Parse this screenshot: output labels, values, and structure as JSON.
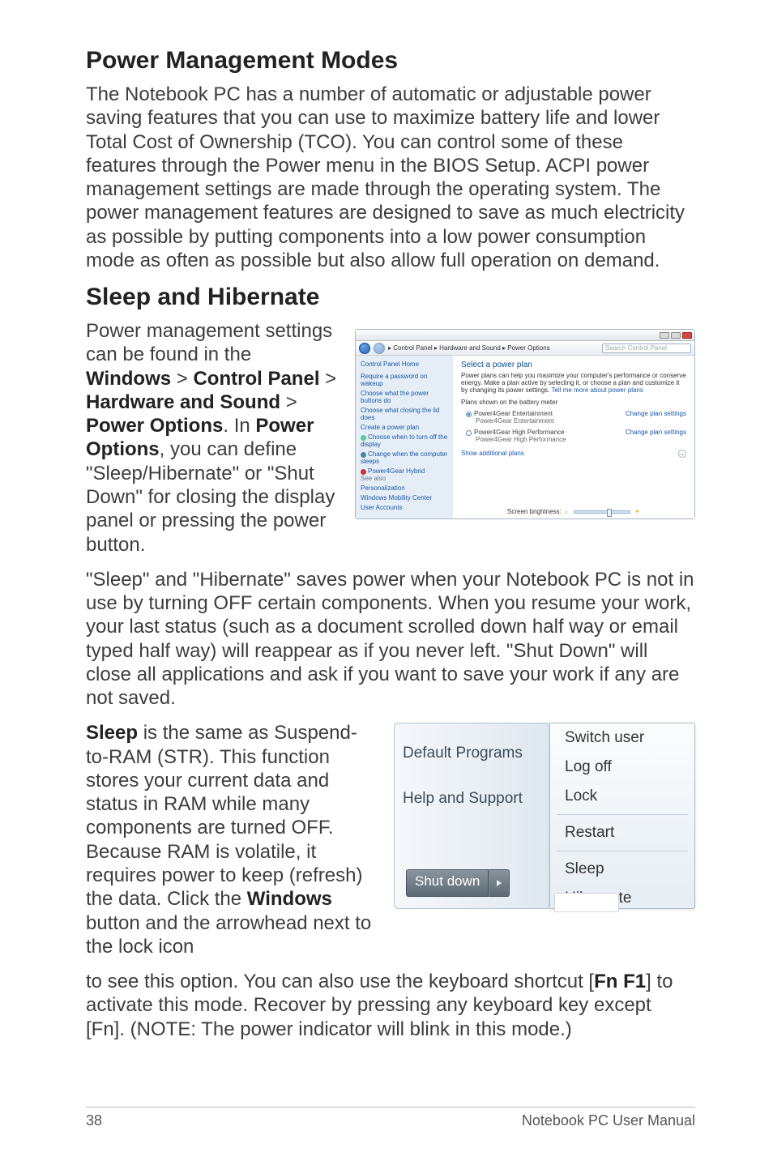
{
  "headings": {
    "h1": "Power Management Modes",
    "h2": "Sleep and Hibernate"
  },
  "paragraphs": {
    "p1": "The Notebook PC has a number of automatic or adjustable power saving features that you can use to maximize battery life and lower Total Cost of Ownership (TCO). You can control some of these features through the Power menu in the BIOS Setup. ACPI power management settings are made through the operating system. The power management features are designed to save as much electricity as possible by putting components into a low power consumption mode as often as possible but also allow full operation on demand.",
    "p2_pre": "Power management settings can be found in the ",
    "p2_b1": "Windows",
    "p2_gt1": " > ",
    "p2_b2": "Control Panel",
    "p2_gt2": " > ",
    "p2_b3": "Hardware and Sound",
    "p2_gt3": " > ",
    "p2_b4": "Power Options",
    "p2_mid": ". In ",
    "p2_b5": "Power Options",
    "p2_post": ", you can define \"Sleep/Hibernate\" or \"Shut Down\" for closing the display panel or pressing the power button.",
    "p3": "\"Sleep\" and \"Hibernate\" saves power when your Notebook PC is not in use by turning OFF certain components. When you resume your work, your last status (such as a document scrolled down half way or email typed half way) will reappear as if you never left. \"Shut Down\" will close all applications and ask if you want to save your work if any are not saved.",
    "p4_b1": "Sleep",
    "p4_a": " is the same as Suspend-to-RAM (STR). This function stores your current data and status in RAM while many components are turned OFF. Because RAM is volatile, it requires power to keep (refresh) the data. Click the ",
    "p4_b2": "Windows",
    "p4_b": " button and the arrowhead next to the lock icon",
    "p5_a": "to see this option. You can also use the keyboard shortcut [",
    "p5_b1": "Fn F1",
    "p5_b": "] to activate this mode. Recover by pressing any keyboard key except [Fn]. (NOTE: The power indicator will blink in this mode.)"
  },
  "shot1": {
    "breadcrumb": "  ▸ Control Panel ▸ Hardware and Sound ▸ Power Options",
    "search_placeholder": "Search Control Panel",
    "side_heading": "Control Panel Home",
    "side_links": {
      "l1": "Require a password on wakeup",
      "l2": "Choose what the power buttons do",
      "l3": "Choose what closing the lid does",
      "l4": "Create a power plan",
      "l5": "Choose when to turn off the display",
      "l6": "Change when the computer sleeps",
      "l7": "Power4Gear Hybrid"
    },
    "see_also": "See also",
    "see_also_links": {
      "a1": "Personalization",
      "a2": "Windows Mobility Center",
      "a3": "User Accounts"
    },
    "main_heading": "Select a power plan",
    "main_desc": "Power plans can help you maximize your computer's performance or conserve energy. Make a plan active by selecting it, or choose a plan and customize it by changing its power settings. ",
    "main_link": "Tell me more about power plans",
    "plans_label": "Plans shown on the battery meter",
    "plan1": "Power4Gear Entertainment",
    "plan1_sub": "Power4Gear Entertainment",
    "plan2": "Power4Gear High Performance",
    "plan2_sub": "Power4Gear High Performance",
    "change": "Change plan settings",
    "show_more": "Show additional plans",
    "brightness": "Screen brightness:"
  },
  "shot2": {
    "left_items": {
      "i1": "Default Programs",
      "i2": "Help and Support"
    },
    "shutdown": "Shut down",
    "menu": {
      "m1": "Switch user",
      "m2": "Log off",
      "m3": "Lock",
      "m4": "Restart",
      "m5": "Sleep",
      "m6": "Hibernate"
    }
  },
  "footer": {
    "page": "38",
    "title": "Notebook PC User Manual"
  }
}
